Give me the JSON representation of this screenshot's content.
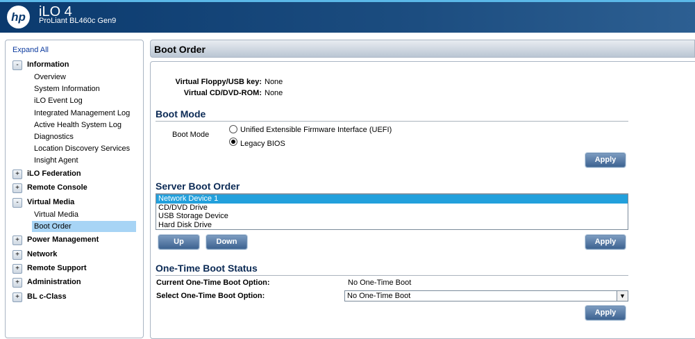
{
  "header": {
    "logo": "hp",
    "title": "iLO 4",
    "subtitle": "ProLiant BL460c Gen9"
  },
  "sidebar": {
    "expand_all": "Expand All",
    "groups": [
      {
        "toggle": "-",
        "label": "Information",
        "children": [
          "Overview",
          "System Information",
          "iLO Event Log",
          "Integrated Management Log",
          "Active Health System Log",
          "Diagnostics",
          "Location Discovery Services",
          "Insight Agent"
        ]
      },
      {
        "toggle": "+",
        "label": "iLO Federation"
      },
      {
        "toggle": "+",
        "label": "Remote Console"
      },
      {
        "toggle": "-",
        "label": "Virtual Media",
        "children": [
          "Virtual Media",
          "Boot Order"
        ]
      },
      {
        "toggle": "+",
        "label": "Power Management"
      },
      {
        "toggle": "+",
        "label": "Network"
      },
      {
        "toggle": "+",
        "label": "Remote Support"
      },
      {
        "toggle": "+",
        "label": "Administration"
      },
      {
        "toggle": "+",
        "label": "BL c-Class"
      }
    ]
  },
  "page": {
    "title": "Boot Order",
    "virtual_floppy_label": "Virtual Floppy/USB key:",
    "virtual_floppy_value": "None",
    "virtual_cd_label": "Virtual CD/DVD-ROM:",
    "virtual_cd_value": "None",
    "boot_mode": {
      "heading": "Boot Mode",
      "label": "Boot Mode",
      "options": [
        "Unified Extensible Firmware Interface (UEFI)",
        "Legacy BIOS"
      ],
      "selected": "Legacy BIOS",
      "apply": "Apply"
    },
    "server_boot_order": {
      "heading": "Server Boot Order",
      "items": [
        "Network Device 1",
        "CD/DVD Drive",
        "USB Storage Device",
        "Hard Disk Drive"
      ],
      "selected": "Network Device 1",
      "up": "Up",
      "down": "Down",
      "apply": "Apply"
    },
    "one_time": {
      "heading": "One-Time Boot Status",
      "current_label": "Current One-Time Boot Option:",
      "current_value": "No One-Time Boot",
      "select_label": "Select One-Time Boot Option:",
      "select_value": "No One-Time Boot",
      "apply": "Apply"
    }
  }
}
